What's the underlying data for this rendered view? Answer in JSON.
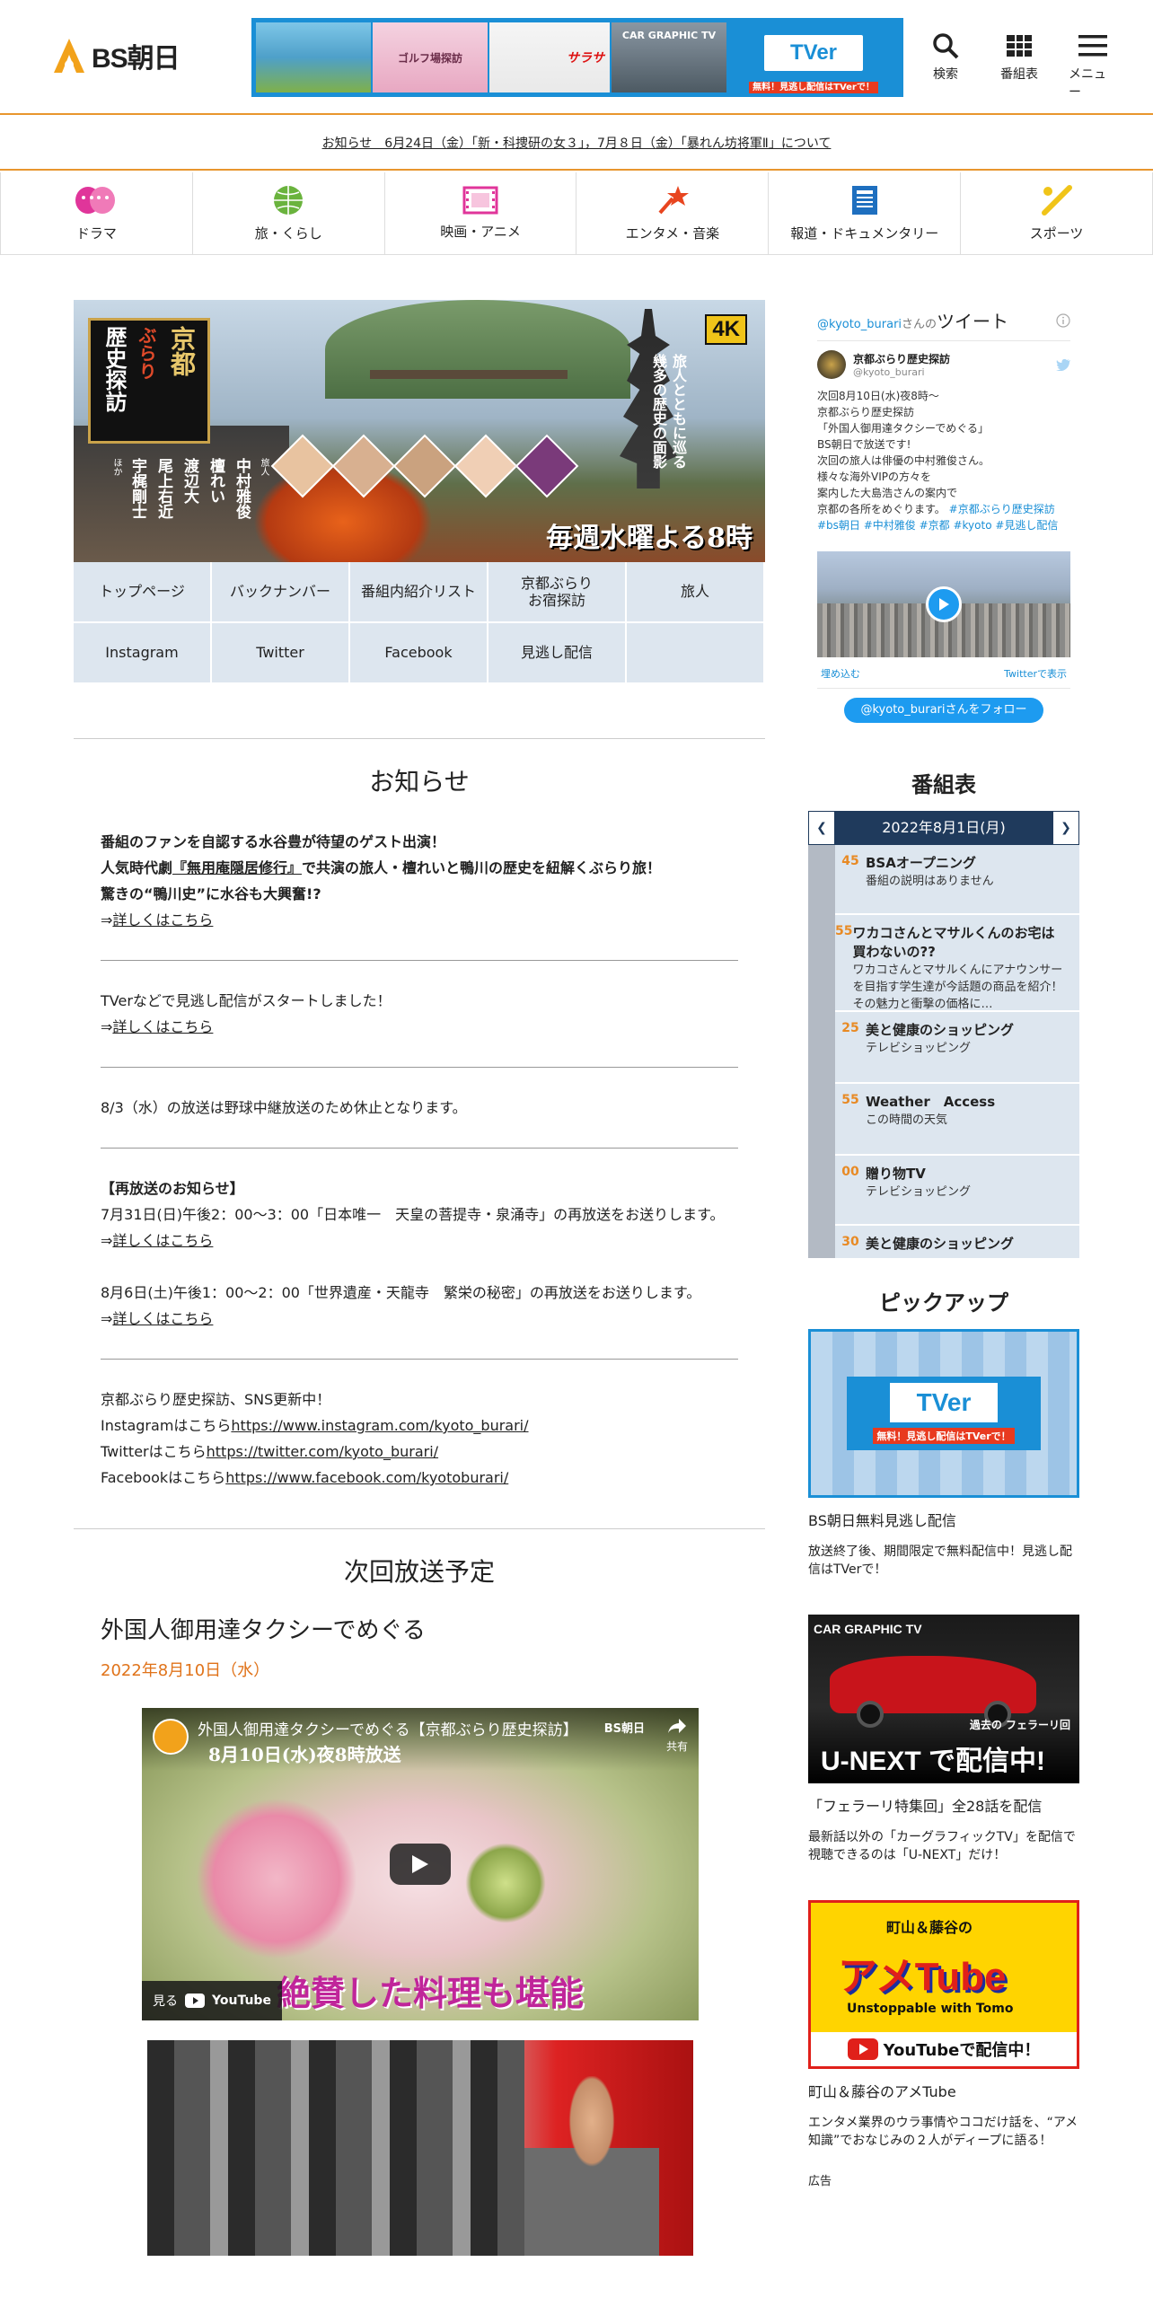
{
  "header": {
    "logo_text": "BS朝日",
    "banner_tver": "TVer",
    "banner_tver_sub": "無料！見逃し配信はTVerで！",
    "banner_thumbs": [
      "ゴルフ場探訪",
      "サラサ",
      "CAR GRAPHIC TV"
    ],
    "nav": [
      {
        "label": "検索",
        "icon": "search-icon"
      },
      {
        "label": "番組表",
        "icon": "grid-icon"
      },
      {
        "label": "メニュー",
        "icon": "menu-icon"
      }
    ]
  },
  "notice_bar": "お知らせ　6月24日（金）「新・科捜研の女３」，7月８日（金）「暴れん坊将軍Ⅱ」について",
  "genres": [
    {
      "label": "ドラマ",
      "icon": "drama-icon",
      "color": "#e0359a"
    },
    {
      "label": "旅・くらし",
      "icon": "globe-icon",
      "color": "#6ab33d"
    },
    {
      "label": "映画・アニメ",
      "icon": "film-icon",
      "color": "#e0359a"
    },
    {
      "label": "エンタメ・音楽",
      "icon": "microphone-icon",
      "color": "#e8451f"
    },
    {
      "label": "報道・ドキュメンタリー",
      "icon": "news-icon",
      "color": "#1e6fbf"
    },
    {
      "label": "スポーツ",
      "icon": "sports-icon",
      "color": "#f0c419"
    }
  ],
  "hero": {
    "title_lines": [
      "京都",
      "ぶらり",
      "歴史探訪"
    ],
    "badge": "4K",
    "catch": "旅人とともに巡る 幾多の歴史の面影",
    "schedule": "毎週水曜よる8時",
    "cast_lines": [
      "旅人",
      "中村雅俊",
      "檀れい",
      "渡辺大",
      "尾上右近",
      "宇梶剛士",
      "ほか"
    ]
  },
  "subnav": [
    "トップページ",
    "バックナンバー",
    "番組内紹介リスト",
    "京都ぶらり\nお宿探訪",
    "旅人",
    "Instagram",
    "Twitter",
    "Facebook",
    "見逃し配信",
    ""
  ],
  "notices_title": "お知らせ",
  "notices": {
    "n1_l1": "番組のファンを自認する水谷豊が待望のゲスト出演！",
    "n1_l2a": "人気時代劇",
    "n1_l2link": "『無用庵隠居修行』",
    "n1_l2b": "で共演の旅人・檀れいと鴨川の歴史を紐解くぶらり旅！",
    "n1_l3": "驚きの“鴨川史”に水谷も大興奮!?",
    "arrow": "⇒",
    "more": "詳しくはこちら",
    "n2_l1": "TVerなどで見逃し配信がスタートしました！",
    "n3_l1": "8/3（水）の放送は野球中継放送のため休止となります。",
    "n4_head": "【再放送のお知らせ】",
    "n4_l1": "7月31日(日)午後2：00～3：00「日本唯一　天皇の菩提寺・泉涌寺」の再放送をお送りします。",
    "n4_l2": "8月6日(土)午後1：00～2：00「世界遺産・天龍寺　繁栄の秘密」の再放送をお送りします。",
    "n5_l1": "京都ぶらり歴史探訪、SNS更新中！",
    "n5_ig_label": "Instagramはこちら",
    "n5_ig": "https://www.instagram.com/kyoto_burari/",
    "n5_tw_label": "Twitterはこちら",
    "n5_tw": "https://twitter.com/kyoto_burari/",
    "n5_fb_label": "Facebookはこちら",
    "n5_fb": "https://www.facebook.com/kyotoburari/"
  },
  "next": {
    "title": "次回放送予定",
    "ep_title": "外国人御用達タクシーでめぐる",
    "ep_date": "2022年8月10日（水）",
    "video_title": "外国人御用達タクシーでめぐる【京都ぶらり歴史探訪】",
    "video_overlay": "8月10日(水)夜8時放送",
    "video_caption": "絶賛した料理も堪能",
    "video_share": "共有",
    "video_watch": "見る",
    "video_yt": "YouTube",
    "video_channel": "BS朝日"
  },
  "twitter": {
    "handle_prefix": "@kyoto_burari",
    "handle_suffix": "さんの",
    "title": "ツイート",
    "account_name": "京都ぶらり歴史探訪",
    "account_id": "@kyoto_burari",
    "tweet_lines": [
      "次回8月10日(水)夜8時〜",
      "京都ぶらり歴史探訪",
      "「外国人御用達タクシーでめぐる」",
      "BS朝日で放送です!",
      "次回の旅人は俳優の中村雅俊さん。",
      "様々な海外VIPの方々を",
      "案内した大島浩さんの案内で",
      "京都の各所をめぐります。"
    ],
    "hashtags_1": "#京都ぶらり歴史探訪",
    "hashtags_2": "#bs朝日 #中村雅俊 #京都 #kyoto #見逃し配信",
    "embed": "埋め込む",
    "view_on": "Twitterで表示",
    "follow": "@kyoto_burariさんをフォロー"
  },
  "schedule": {
    "title": "番組表",
    "date": "2022年8月1日(月)",
    "programs": [
      {
        "min": "45",
        "name": "BSAオープニング",
        "desc": "番組の説明はありません"
      },
      {
        "min": "55",
        "name": "ワカコさんとマサルくんのお宅は買わないの??",
        "desc": "ワカコさんとマサルくんにアナウンサーを目指す学生達が今話題の商品を紹介！その魅力と衝撃の価格に…"
      },
      {
        "min": "25",
        "name": "美と健康のショッピング",
        "desc": "テレビショッピング"
      },
      {
        "min": "55",
        "name": "Weather　Access",
        "desc": "この時間の天気"
      },
      {
        "min": "00",
        "name": "贈り物TV",
        "desc": "テレビショッピング"
      },
      {
        "min": "30",
        "name": "美と健康のショッピング",
        "desc": ""
      }
    ]
  },
  "pickup": {
    "title": "ピックアップ",
    "items": [
      {
        "title": "BS朝日無料見逃し配信",
        "desc": "放送終了後、期間限定で無料配信中！見逃し配信はTVerで！",
        "img_text": "TVer",
        "img_sub": "無料！見逃し配信はTVerで！"
      },
      {
        "title": "「フェラーリ特集回」全28話を配信",
        "desc": "最新話以外の「カーグラフィックTV」を配信で視聴できるのは「U-NEXT」だけ！",
        "img_text": "U-NEXT で配信中!",
        "img_sub": "過去の フェラーリ回",
        "img_top": "CAR GRAPHIC TV"
      },
      {
        "title": "町山＆藤谷のアメTube",
        "desc": "エンタメ業界のウラ事情やココだけ話を、“アメ知識”でおなじみの２人がディープに語る！",
        "img_text": "アメTube",
        "img_sub": "YouTubeで配信中！",
        "img_top": "町山＆藤谷の",
        "img_mid": "Unstoppable with Tomo"
      }
    ]
  },
  "ad_label": "広告"
}
